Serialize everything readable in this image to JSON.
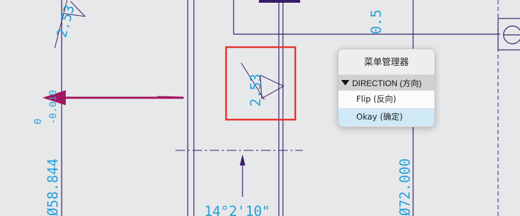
{
  "drawing": {
    "roughness_top": "2.53",
    "roughness_selected": "2.53",
    "top_dim_value": "0.5",
    "diameter_left": "Ø58.844",
    "tolerance_left_upper": "0",
    "tolerance_left_lower": "-0.010",
    "diameter_right": "Ø72.000",
    "angle_dim": "14°2'10\""
  },
  "menu_manager": {
    "title": "菜单管理器",
    "section_label": "DIRECTION (方向)",
    "items": [
      {
        "label": "Flip (反向)",
        "active": false
      },
      {
        "label": "Okay (确定)",
        "active": true
      }
    ]
  },
  "colors": {
    "line": "#3a1a6b",
    "dimension_text": "#2aa0d8",
    "arrow": "#a3155e",
    "highlight_box": "#e8322b"
  }
}
